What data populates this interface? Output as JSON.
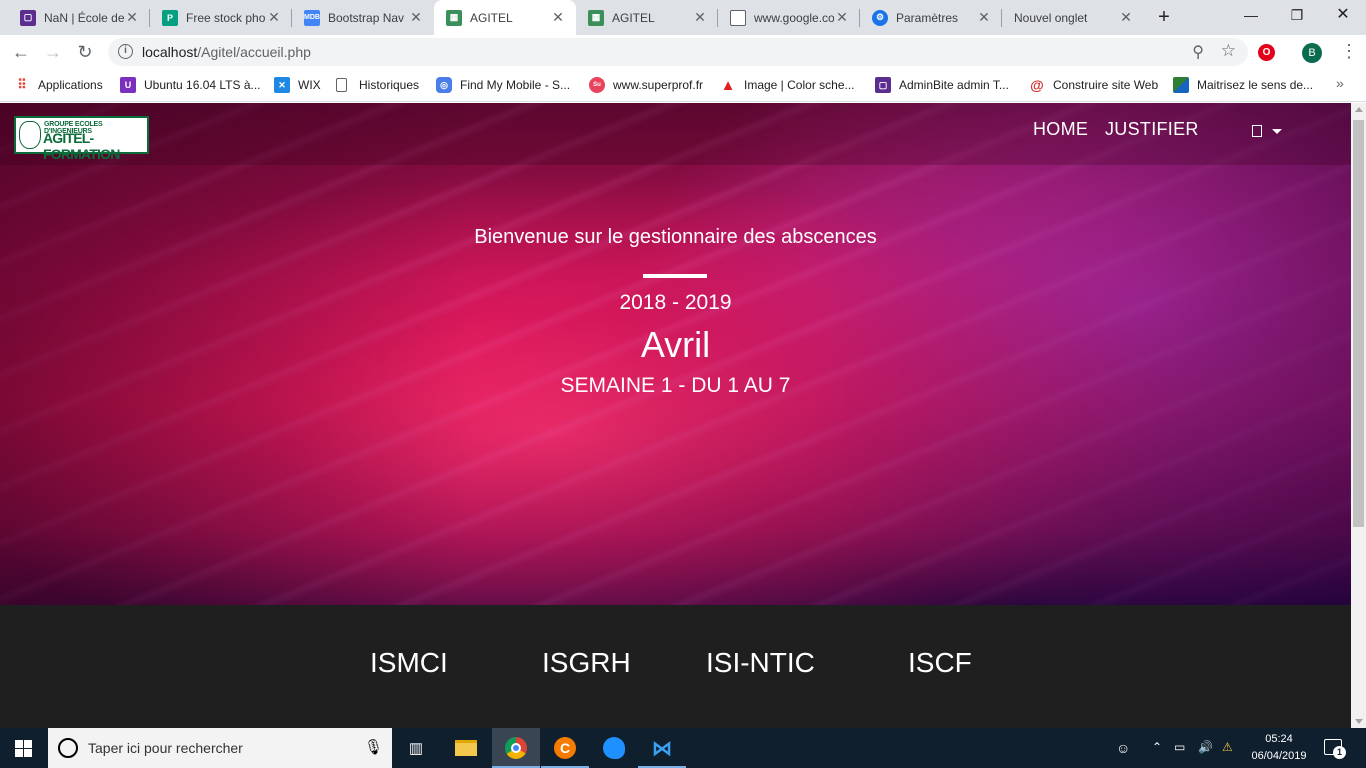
{
  "browser": {
    "tabs": [
      {
        "title": "NaN | École de",
        "favicon": "purple-square-icon",
        "color": "#5b2d8e",
        "active": false
      },
      {
        "title": "Free stock pho",
        "favicon": "pexels-icon",
        "color": "#05a081",
        "active": false
      },
      {
        "title": "Bootstrap Nav",
        "favicon": "mdb-icon",
        "color": "#4285f4",
        "active": false
      },
      {
        "title": "AGITEL",
        "favicon": "agitel-icon",
        "color": "#3a8f5a",
        "active": true
      },
      {
        "title": "AGITEL",
        "favicon": "agitel-icon",
        "color": "#3a8f5a",
        "active": false
      },
      {
        "title": "www.google.co",
        "favicon": "page-icon",
        "color": "#ffffff",
        "active": false
      },
      {
        "title": "Paramètres",
        "favicon": "gear-icon",
        "color": "#1a73e8",
        "active": false
      },
      {
        "title": "Nouvel onglet",
        "favicon": "",
        "color": "",
        "active": false
      }
    ],
    "url_host": "localhost",
    "url_path": "/Agitel/accueil.php",
    "avatar_letter": "B",
    "bookmarks": [
      {
        "label": "Applications",
        "icon": "apps-grid-icon",
        "color": "#e94235"
      },
      {
        "label": "Ubuntu 16.04 LTS à...",
        "icon": "uf-icon",
        "color": "#7b2fbf"
      },
      {
        "label": "WIX",
        "icon": "wix-icon",
        "color": "#1e88e5"
      },
      {
        "label": "Historiques",
        "icon": "page-icon",
        "color": "#ffffff"
      },
      {
        "label": "Find My Mobile - S...",
        "icon": "findmymobile-icon",
        "color": "#4a7de8"
      },
      {
        "label": "www.superprof.fr",
        "icon": "superprof-icon",
        "color": "#e8425c"
      },
      {
        "label": "Image | Color sche...",
        "icon": "adobe-icon",
        "color": "#e0201b"
      },
      {
        "label": "AdminBite admin T...",
        "icon": "adminbite-icon",
        "color": "#5b2d8e"
      },
      {
        "label": "Construire site Web",
        "icon": "swirl-icon",
        "color": "#d32f2f"
      },
      {
        "label": "Maitrisez le sens de...",
        "icon": "triangle-icon",
        "color": "#2e7d32"
      }
    ]
  },
  "page": {
    "logo": {
      "line1": "GROUPE ECOLES D'INGENIEURS",
      "line2": "AGITEL-FORMATION"
    },
    "nav": {
      "home": "HOME",
      "justifier": "JUSTIFIER"
    },
    "hero": {
      "welcome": "Bienvenue sur le gestionnaire des abscences",
      "years": "2018 - 2019",
      "month": "Avril",
      "week": "SEMAINE 1 - DU 1 AU 7"
    },
    "schools": [
      "ISMCI",
      "ISGRH",
      "ISI-NTIC",
      "ISCF"
    ]
  },
  "taskbar": {
    "search_placeholder": "Taper ici pour rechercher",
    "time": "05:24",
    "date": "06/04/2019",
    "notifications": "1"
  }
}
